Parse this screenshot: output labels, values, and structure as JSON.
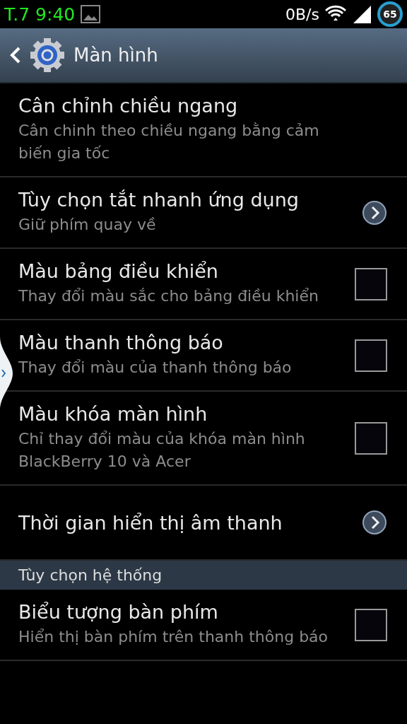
{
  "status_bar": {
    "time": "T.7 9:40",
    "speed": "0B/s",
    "battery": "65"
  },
  "action_bar": {
    "title": "Màn hình"
  },
  "items": [
    {
      "kind": "plain",
      "title": "Cân chỉnh chiều ngang",
      "summary": "Cân chinh theo chiều ngang bằng cảm biến gia tốc"
    },
    {
      "kind": "arrow",
      "title": "Tùy chọn tắt nhanh ứng dụng",
      "summary": "Giữ phím quay về"
    },
    {
      "kind": "checkbox",
      "title": "Màu bảng điều khiển",
      "summary": "Thay đổi màu sắc cho bảng điều khiển",
      "checked": false
    },
    {
      "kind": "checkbox",
      "title": "Màu thanh thông báo",
      "summary": "Thay đổi màu của thanh thông báo",
      "checked": false
    },
    {
      "kind": "checkbox",
      "title": "Màu khóa màn hình",
      "summary": "Chỉ thay đổi màu của khóa màn hình BlackBerry 10 và Acer",
      "checked": false
    },
    {
      "kind": "arrow",
      "title": "Thời gian hiển thị âm thanh"
    },
    {
      "kind": "header",
      "title": "Tùy chọn hệ thống"
    },
    {
      "kind": "checkbox",
      "title": "Biểu tượng bàn phím",
      "summary": "Hiển thị bàn phím trên thanh thông báo",
      "checked": false
    }
  ]
}
